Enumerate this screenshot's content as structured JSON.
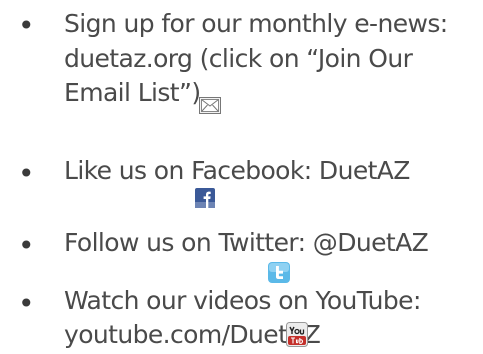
{
  "list": {
    "bullet": "•",
    "items": [
      {
        "lines": [
          "Sign up for our monthly e-news:",
          "duetaz.org (click on “Join Our",
          "Email List”)"
        ],
        "icon": "email-envelope-icon"
      },
      {
        "lines": [
          "Like us on Facebook: DuetAZ"
        ],
        "icon": "facebook-icon"
      },
      {
        "lines": [
          "Follow us on Twitter: @DuetAZ"
        ],
        "icon": "twitter-icon"
      },
      {
        "lines": [
          "Watch our videos on YouTube:",
          "youtube.com/DuetAZ"
        ],
        "icon": "youtube-icon"
      }
    ]
  },
  "colors": {
    "text": "#4a4a4a",
    "facebook": "#3b5998",
    "twitter": "#5bb9e8",
    "youtube": "#c4302b"
  }
}
